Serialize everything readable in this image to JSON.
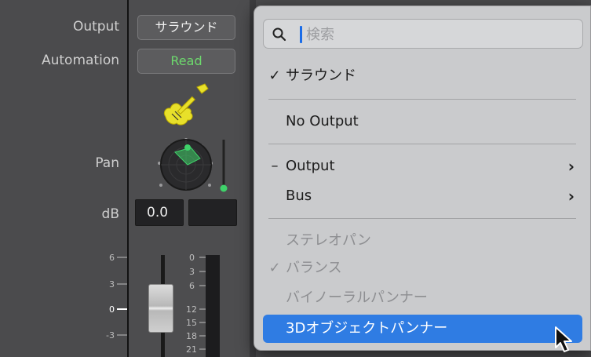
{
  "labels": {
    "output": "Output",
    "automation": "Automation",
    "pan": "Pan",
    "db": "dB"
  },
  "strip": {
    "output_value": "サラウンド",
    "automation_mode": "Read",
    "db_value": "0.0",
    "fader_scale": [
      "6",
      "3",
      "0",
      "-3"
    ],
    "meter_scale": [
      "0",
      "3",
      "6",
      "12",
      "15",
      "18",
      "21"
    ]
  },
  "colors": {
    "automation_text": "#6dd96d",
    "selection": "#2f7ce3",
    "pan_accent": "#3fd26a",
    "guitar": "#e8e02a"
  },
  "icons": {
    "instrument": "electric-guitar-icon",
    "search": "magnifier-icon",
    "check": "checkmark",
    "submenu": "chevron-right"
  },
  "menu": {
    "search_placeholder": "検索",
    "items": {
      "surround": "サラウンド",
      "no_output": "No Output",
      "output": "Output",
      "bus": "Bus",
      "stereo_pan": "ステレオパン",
      "balance": "バランス",
      "binaural": "バイノーラルパンナー",
      "object_3d": "3Dオブジェクトパンナー"
    },
    "marks": {
      "check": "✓",
      "mixed": "–",
      "submenu": "›"
    }
  }
}
